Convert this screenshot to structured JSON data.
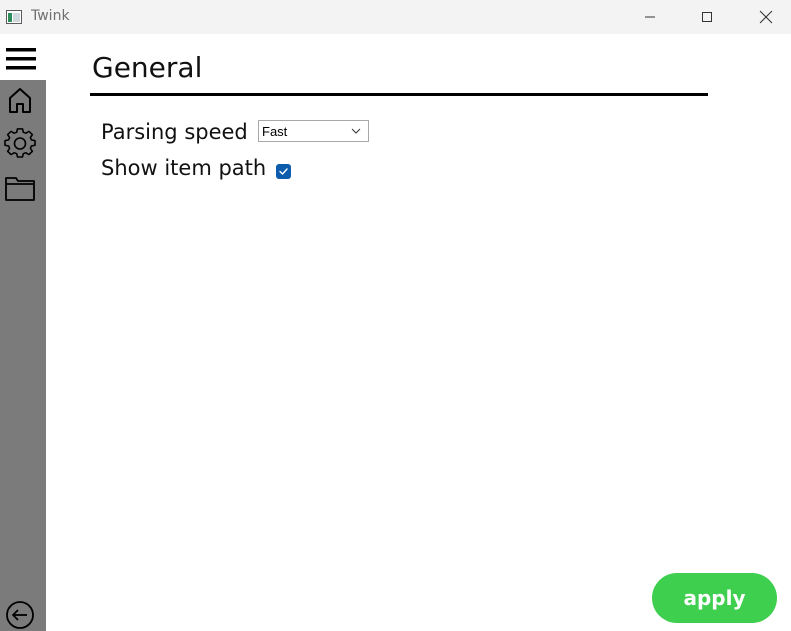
{
  "window": {
    "title": "Twink"
  },
  "sidebar": {
    "items": [
      {
        "icon": "menu-icon"
      },
      {
        "icon": "home-icon"
      },
      {
        "icon": "gear-icon"
      },
      {
        "icon": "folder-icon"
      },
      {
        "icon": "back-arrow-icon"
      }
    ],
    "background": "#7b7b7b"
  },
  "page": {
    "heading": "General"
  },
  "settings": {
    "parsing_speed": {
      "label": "Parsing speed",
      "selected": "Fast"
    },
    "show_item_path": {
      "label": "Show item path",
      "checked": true
    }
  },
  "actions": {
    "apply_label": "apply"
  },
  "colors": {
    "accent_checkbox": "#0b5cad",
    "apply_button": "#3fcf4f"
  }
}
